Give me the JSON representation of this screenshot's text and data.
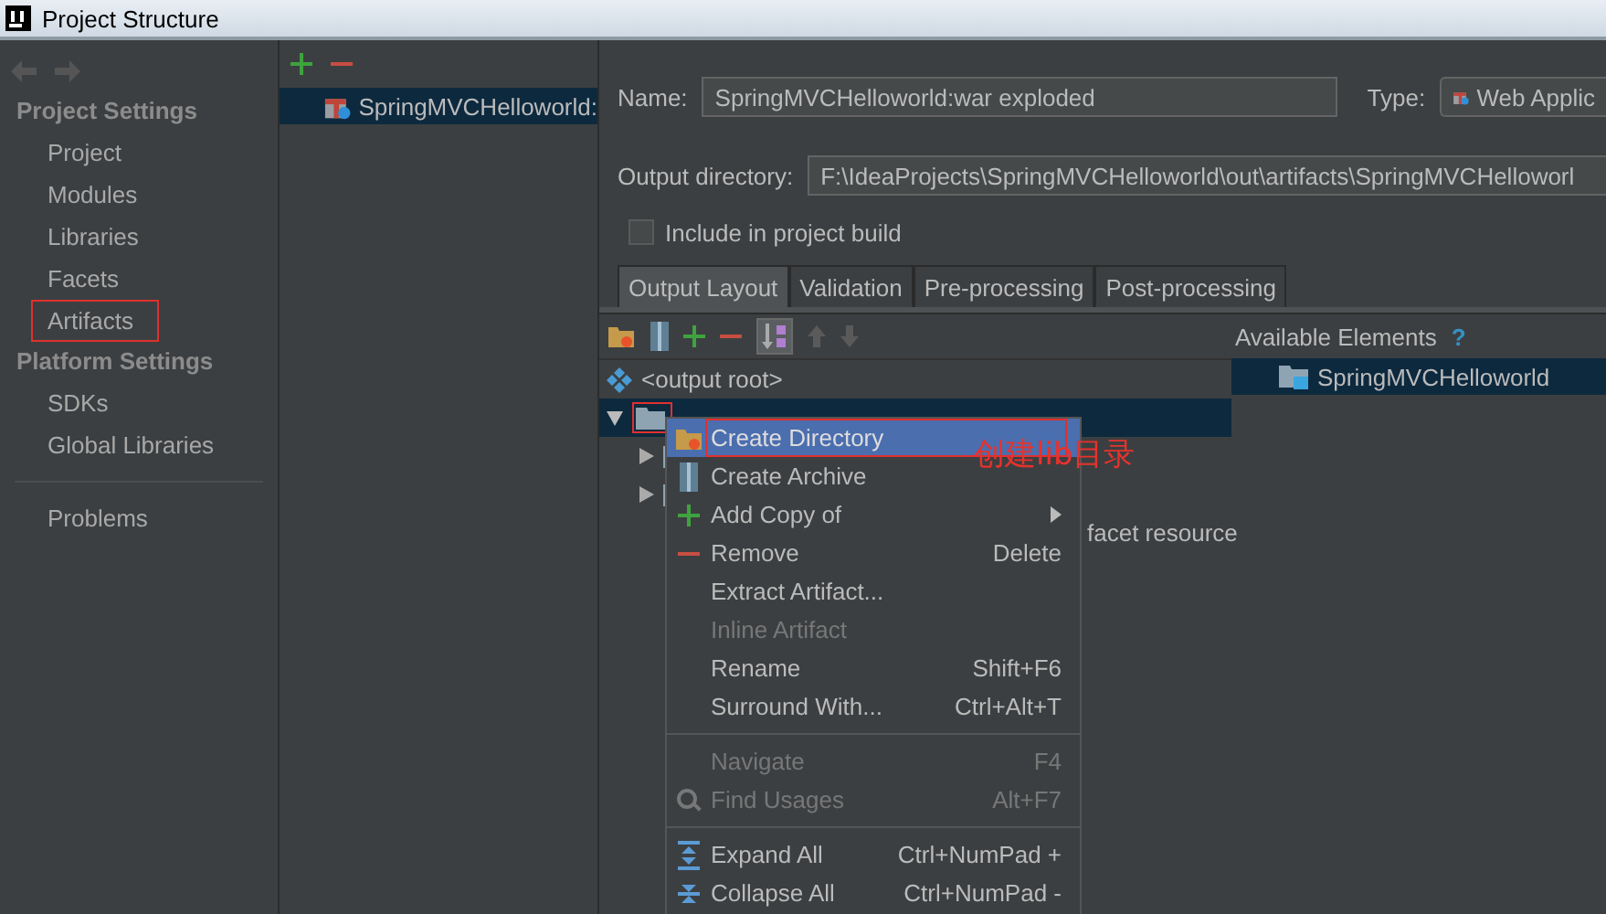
{
  "window": {
    "title": "Project Structure"
  },
  "sidebar": {
    "sections": [
      {
        "title": "Project Settings",
        "items": [
          {
            "label": "Project",
            "selected": false,
            "annotated": false
          },
          {
            "label": "Modules",
            "selected": false,
            "annotated": false
          },
          {
            "label": "Libraries",
            "selected": false,
            "annotated": false
          },
          {
            "label": "Facets",
            "selected": false,
            "annotated": false
          },
          {
            "label": "Artifacts",
            "selected": false,
            "annotated": true
          }
        ]
      },
      {
        "title": "Platform Settings",
        "items": [
          {
            "label": "SDKs",
            "selected": false,
            "annotated": false
          },
          {
            "label": "Global Libraries",
            "selected": false,
            "annotated": false
          }
        ]
      }
    ],
    "footer_items": [
      {
        "label": "Problems",
        "selected": false,
        "annotated": false
      }
    ]
  },
  "artifacts_list": {
    "items": [
      {
        "label": "SpringMVCHelloworld:",
        "selected": true
      }
    ]
  },
  "name_field": {
    "label": "Name:",
    "value": "SpringMVCHelloworld:war exploded"
  },
  "type_field": {
    "label": "Type:",
    "value": "Web Applic"
  },
  "output_directory": {
    "label": "Output directory:",
    "value": "F:\\IdeaProjects\\SpringMVCHelloworld\\out\\artifacts\\SpringMVCHelloworl"
  },
  "include_in_build": {
    "label": "Include in project build",
    "checked": false
  },
  "tabs": [
    {
      "label": "Output Layout",
      "selected": true
    },
    {
      "label": "Validation",
      "selected": false
    },
    {
      "label": "Pre-processing",
      "selected": false
    },
    {
      "label": "Post-processing",
      "selected": false
    }
  ],
  "tree": [
    {
      "kind": "root",
      "label": "<output root>",
      "selected": false,
      "annotated": false
    },
    {
      "kind": "folder",
      "selected": true,
      "expanded": true,
      "annotated": true,
      "children": [
        {
          "kind": "folder",
          "expanded": false,
          "selected": false,
          "annotated": false
        },
        {
          "kind": "folder",
          "expanded": false,
          "selected": false,
          "annotated": false
        },
        {
          "kind": "facet",
          "label": "facet resource",
          "selected": false,
          "annotated": false
        }
      ]
    }
  ],
  "available_elements": {
    "title": "Available Elements",
    "help": "?",
    "items": [
      {
        "label": "SpringMVCHelloworld",
        "selected": true
      }
    ]
  },
  "context_menu": {
    "items": [
      {
        "kind": "item",
        "label": "Create Directory",
        "selected": true,
        "disabled": false,
        "annotated": true
      },
      {
        "kind": "item",
        "label": "Create Archive",
        "selected": false,
        "disabled": false,
        "annotated": false
      },
      {
        "kind": "item",
        "label": "Add Copy of",
        "selected": false,
        "disabled": false,
        "submenu": true,
        "annotated": false
      },
      {
        "kind": "item",
        "label": "Remove",
        "shortcut": "Delete",
        "selected": false,
        "disabled": false,
        "annotated": false
      },
      {
        "kind": "item",
        "label": "Extract Artifact...",
        "selected": false,
        "disabled": false,
        "annotated": false
      },
      {
        "kind": "item",
        "label": "Inline Artifact",
        "selected": false,
        "disabled": true,
        "annotated": false
      },
      {
        "kind": "item",
        "label": "Rename",
        "shortcut": "Shift+F6",
        "selected": false,
        "disabled": false,
        "annotated": false
      },
      {
        "kind": "item",
        "label": "Surround With...",
        "shortcut": "Ctrl+Alt+T",
        "selected": false,
        "disabled": false,
        "annotated": false
      },
      {
        "kind": "separator"
      },
      {
        "kind": "item",
        "label": "Navigate",
        "shortcut": "F4",
        "selected": false,
        "disabled": true,
        "annotated": false
      },
      {
        "kind": "item",
        "label": "Find Usages",
        "shortcut": "Alt+F7",
        "selected": false,
        "disabled": true,
        "annotated": false
      },
      {
        "kind": "separator"
      },
      {
        "kind": "item",
        "label": "Expand All",
        "shortcut": "Ctrl+NumPad +",
        "selected": false,
        "disabled": false,
        "annotated": false
      },
      {
        "kind": "item",
        "label": "Collapse All",
        "shortcut": "Ctrl+NumPad -",
        "selected": false,
        "disabled": false,
        "annotated": false
      }
    ]
  },
  "annotation": {
    "text": "创建lib目录"
  }
}
